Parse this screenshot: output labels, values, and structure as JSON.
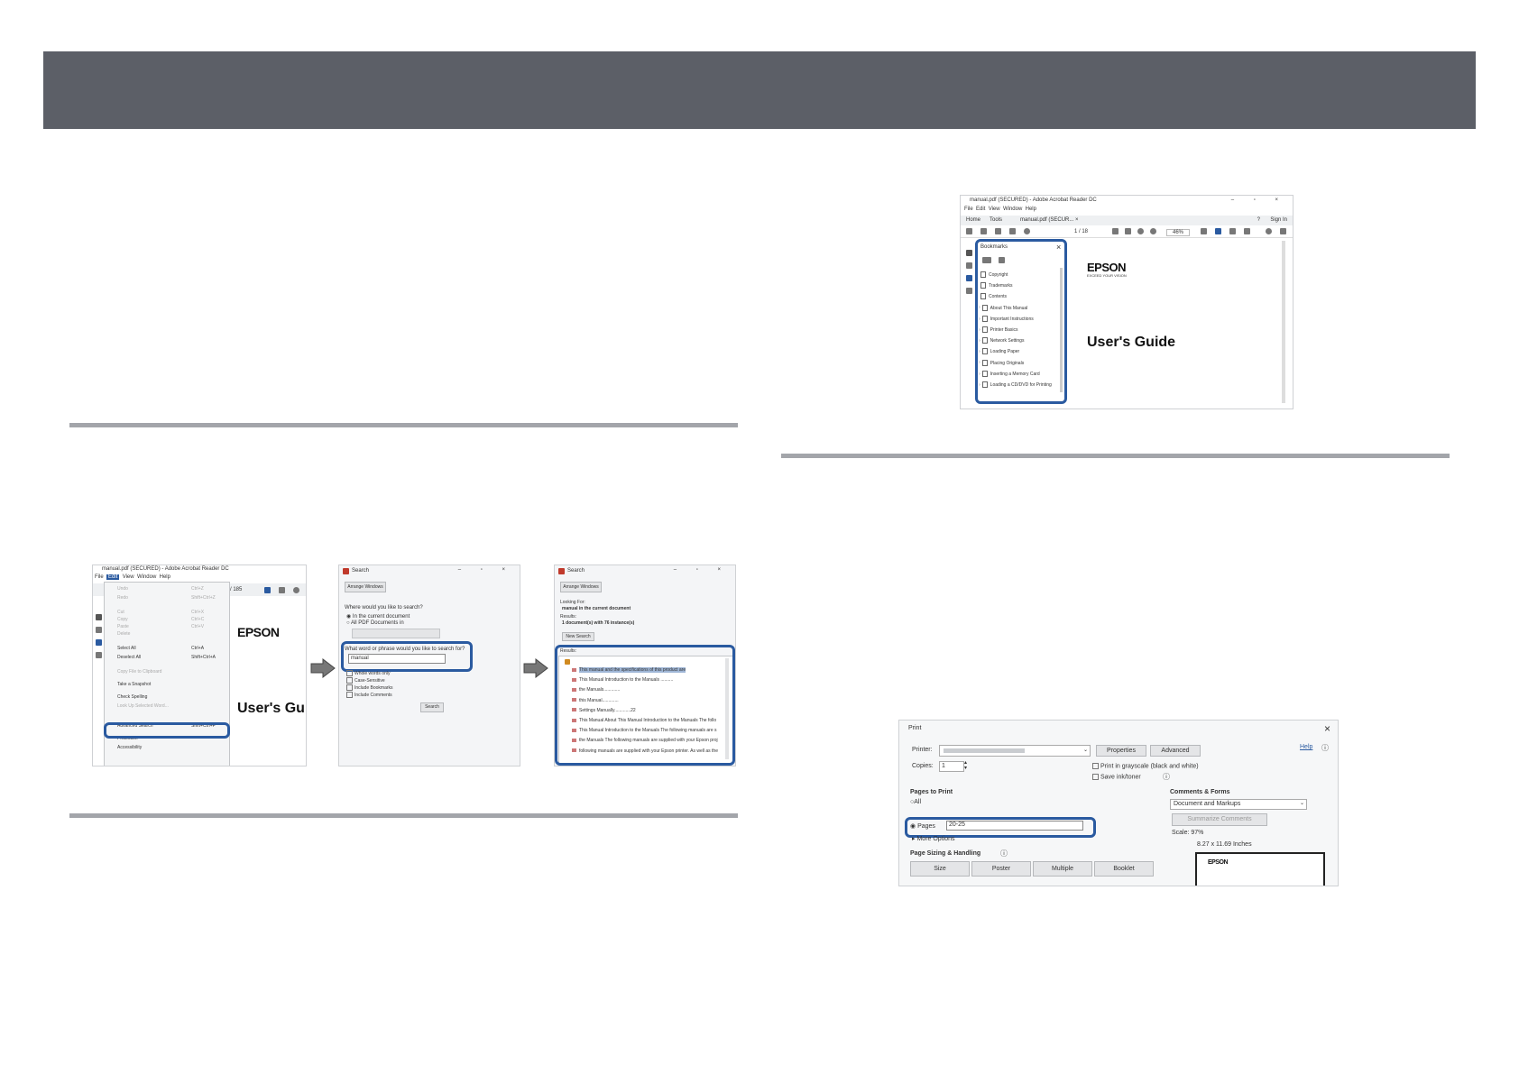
{
  "search_shot": {
    "window_title": "manual.pdf (SECURED) - Adobe Acrobat Reader DC",
    "menu": [
      "File",
      "Edit",
      "View",
      "Window",
      "Help"
    ],
    "edit_menu": [
      "Undo",
      "Redo",
      "Cut",
      "Copy",
      "Paste",
      "Delete",
      "Select All",
      "Deselect All",
      "Copy File to Clipboard",
      "Take a Snapshot",
      "Check Spelling",
      "Look Up Selected Word...",
      "Advanced Search",
      "Protection",
      "Accessibility"
    ],
    "edit_menu_shortcuts": [
      "Ctrl+Z",
      "Shift+Ctrl+Z",
      "Ctrl+X",
      "Ctrl+C",
      "Ctrl+V",
      "",
      "Ctrl+A",
      "Shift+Ctrl+A",
      "",
      "",
      "",
      "",
      "Shift+Ctrl+F",
      "",
      ""
    ],
    "page_count": "/ 185",
    "logo": "EPSON",
    "doc_title": "User's Gu",
    "dialog1": {
      "title": "Search",
      "arrange_windows": "Arrange Windows",
      "where_label": "Where would you like to search?",
      "opt_current": "In the current document",
      "opt_all": "All PDF Documents in",
      "what_label": "What word or phrase would you like to search for?",
      "search_value": "manual",
      "options": [
        "Whole words only",
        "Case-Sensitive",
        "Include Bookmarks",
        "Include Comments"
      ],
      "search_button": "Search"
    },
    "dialog2": {
      "title": "Search",
      "arrange_windows": "Arrange Windows",
      "looking_for": "Looking For:",
      "looking_value": "manual in the current document",
      "results_label": "Results:",
      "results_value": "1 document(s) with 76 instance(s)",
      "new_search": "New Search",
      "results_header": "Results:",
      "results": [
        "This manual and the specifications of this product are",
        "This Manual Introduction to the Manuals ..........",
        "the Manuals.............",
        "this Manual.............",
        "Settings Manually.............22",
        "This Manual About This Manual Introduction to the Manuals The follo",
        "This Manual Introduction to the Manuals The following manuals are s",
        "the Manuals The following manuals are supplied with your Epson proj",
        "following manuals are supplied with your Epson printer. As well as the"
      ]
    }
  },
  "bookmarks_shot": {
    "window_title": "manual.pdf (SECURED) - Adobe Acrobat Reader DC",
    "menu": [
      "File",
      "Edit",
      "View",
      "Window",
      "Help"
    ],
    "tabs": [
      "Home",
      "Tools",
      "manual.pdf (SECUR... ×"
    ],
    "help_icon": "?",
    "sign_in": "Sign In",
    "page_info": "1 / 18",
    "zoom": "46%",
    "panel_title": "Bookmarks",
    "items": [
      "Copyright",
      "Trademarks",
      "Contents",
      "About This Manual",
      "Important Instructions",
      "Printer Basics",
      "Network Settings",
      "Loading Paper",
      "Placing Originals",
      "Inserting a Memory Card",
      "Loading a CD/DVD for Printing"
    ],
    "logo": "EPSON",
    "logo_tagline": "EXCEED YOUR VISION",
    "doc_title": "User's Guide"
  },
  "print_shot": {
    "title": "Print",
    "printer_label": "Printer:",
    "properties": "Properties",
    "advanced": "Advanced",
    "help": "Help",
    "copies_label": "Copies:",
    "copies_value": "1",
    "grayscale": "Print in grayscale (black and white)",
    "save_ink": "Save ink/toner",
    "pages_to_print": "Pages to Print",
    "opt_all": "All",
    "opt_pages": "Pages",
    "pages_value": "20-25",
    "more_options": "More Options",
    "comments_forms": "Comments & Forms",
    "comments_value": "Document and Markups",
    "summarize": "Summarize Comments",
    "scale": "Scale: 97%",
    "paper_size": "8.27 x 11.69 Inches",
    "page_sizing": "Page Sizing & Handling",
    "sizing_buttons": [
      "Size",
      "Poster",
      "Multiple",
      "Booklet"
    ],
    "preview_logo": "EPSON"
  }
}
